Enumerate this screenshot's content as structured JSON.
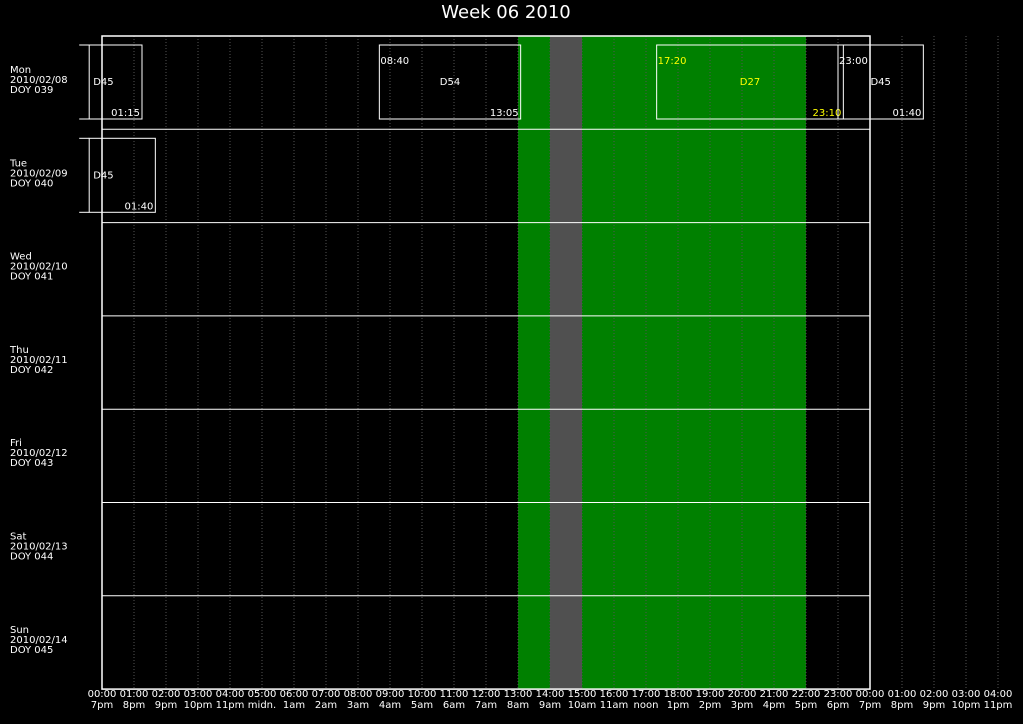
{
  "title": "Week 06 2010",
  "colors": {
    "background": "#000000",
    "frame": "#ffffff",
    "band_green": "#008000",
    "band_gray": "#505050",
    "highlight_text": "#ffff00",
    "dotted_grid": "#555555"
  },
  "days": [
    {
      "name": "Mon",
      "date": "2010/02/08",
      "doy": "DOY 039"
    },
    {
      "name": "Tue",
      "date": "2010/02/09",
      "doy": "DOY 040"
    },
    {
      "name": "Wed",
      "date": "2010/02/10",
      "doy": "DOY 041"
    },
    {
      "name": "Thu",
      "date": "2010/02/11",
      "doy": "DOY 042"
    },
    {
      "name": "Fri",
      "date": "2010/02/12",
      "doy": "DOY 043"
    },
    {
      "name": "Sat",
      "date": "2010/02/13",
      "doy": "DOY 044"
    },
    {
      "name": "Sun",
      "date": "2010/02/14",
      "doy": "DOY 045"
    }
  ],
  "time_axis": {
    "utc": [
      "00:00",
      "01:00",
      "02:00",
      "03:00",
      "04:00",
      "05:00",
      "06:00",
      "07:00",
      "08:00",
      "09:00",
      "10:00",
      "11:00",
      "12:00",
      "13:00",
      "14:00",
      "15:00",
      "16:00",
      "17:00",
      "18:00",
      "19:00",
      "20:00",
      "21:00",
      "22:00",
      "23:00",
      "00:00",
      "01:00",
      "02:00",
      "03:00",
      "04:00"
    ],
    "local": [
      "7pm",
      "8pm",
      "9pm",
      "10pm",
      "11pm",
      "midn.",
      "1am",
      "2am",
      "3am",
      "4am",
      "5am",
      "6am",
      "7am",
      "8am",
      "9am",
      "10am",
      "11am",
      "noon",
      "1pm",
      "2pm",
      "3pm",
      "4pm",
      "5pm",
      "6pm",
      "7pm",
      "8pm",
      "9pm",
      "10pm",
      "11pm"
    ]
  },
  "bands": [
    {
      "kind": "green",
      "start_hour": 13.0,
      "end_hour": 14.0
    },
    {
      "kind": "gray",
      "start_hour": 14.0,
      "end_hour": 15.0
    },
    {
      "kind": "green",
      "start_hour": 15.0,
      "end_hour": 22.0
    }
  ],
  "passes": [
    {
      "day": 0,
      "station": "D45",
      "start_hour": -1.0,
      "end_hour": 1.25,
      "start_label": "",
      "end_label": "01:15",
      "highlight": false,
      "edge_tick": true
    },
    {
      "day": 0,
      "station": "D54",
      "start_hour": 8.667,
      "end_hour": 13.083,
      "start_label": "08:40",
      "end_label": "13:05",
      "highlight": false,
      "edge_tick": false
    },
    {
      "day": 0,
      "station": "D27",
      "start_hour": 17.333,
      "end_hour": 23.167,
      "start_label": "17:20",
      "end_label": "23:10",
      "highlight": true,
      "edge_tick": false
    },
    {
      "day": 0,
      "station": "D45",
      "start_hour": 23.0,
      "end_hour": 25.667,
      "start_label": "23:00",
      "end_label": "01:40",
      "highlight": false,
      "edge_tick": false
    },
    {
      "day": 1,
      "station": "D45",
      "start_hour": -1.0,
      "end_hour": 1.667,
      "start_label": "",
      "end_label": "01:40",
      "highlight": false,
      "edge_tick": true
    }
  ]
}
